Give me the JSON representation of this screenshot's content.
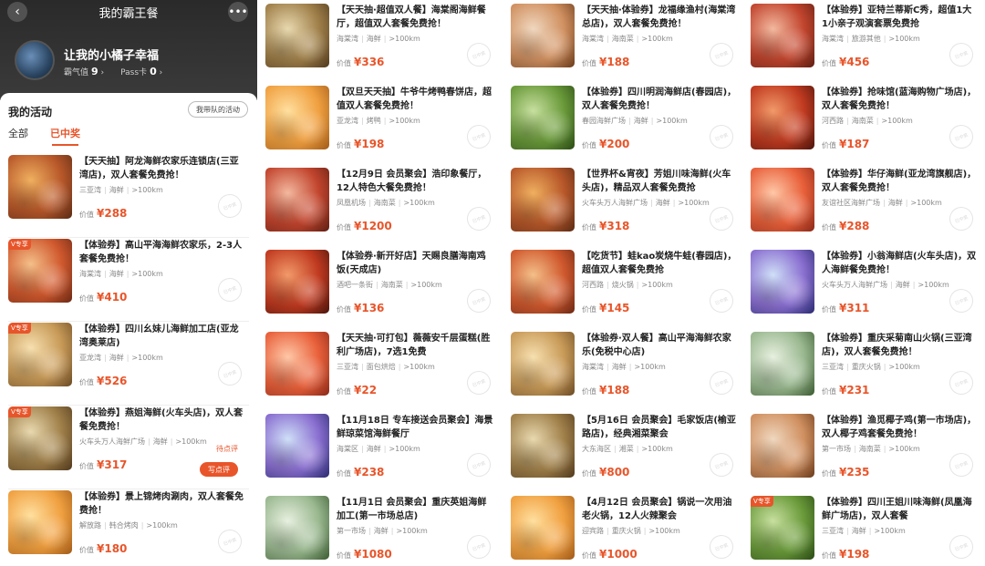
{
  "phone": {
    "title": "我的霸王餐",
    "back_icon": "chevron-left-icon",
    "more_icon": "more-dots-icon",
    "user_name": "让我的小橘子幸福",
    "popularity_label": "霸气值",
    "popularity_value": "9",
    "pass_label": "Pass卡",
    "pass_value": "0",
    "section_title": "我的活动",
    "team_button": "我带队的活动",
    "tabs": [
      "全部",
      "已中奖"
    ],
    "active_tab": "已中奖",
    "stamp_text": "已中奖",
    "pending_label": "待点评",
    "review_button": "写点评",
    "price_label": "价值",
    "accent_color": "#e8552a"
  },
  "phone_items": [
    {
      "title": "【天天抽】阿龙海鲜农家乐连锁店(三亚湾店)，双人套餐免费抢！",
      "area": "三亚湾",
      "cuisine": "海鲜",
      "distance": ">100km",
      "price": "¥288",
      "badge": ""
    },
    {
      "title": "【体验券】高山平海海鲜农家乐，2-3人套餐免费抢！",
      "area": "海棠湾",
      "cuisine": "海鲜",
      "distance": ">100km",
      "price": "¥410",
      "badge": "V专享"
    },
    {
      "title": "【体验券】四川幺妹儿海鲜加工店(亚龙湾奥莱店)",
      "area": "亚龙湾",
      "cuisine": "海鲜",
      "distance": ">100km",
      "price": "¥526",
      "badge": "V专享"
    },
    {
      "title": "【体验券】燕姐海鲜(火车头店)，双人套餐免费抢！",
      "area": "火车头万人海鲜广场",
      "cuisine": "海鲜",
      "distance": ">100km",
      "price": "¥317",
      "badge": "V专享",
      "pending": true
    },
    {
      "title": "【体验券】景上锦烤肉涮肉，双人套餐免费抢！",
      "area": "解放路",
      "cuisine": "韩合烤肉",
      "distance": ">100km",
      "price": "¥180",
      "badge": ""
    }
  ],
  "grid_columns": [
    [
      {
        "title": "【天天抽·超值双人餐】海棠阁海鲜餐厅，超值双人套餐免费抢！",
        "area": "海棠湾",
        "cuisine": "海鲜",
        "distance": ">100km",
        "price": "¥336",
        "badge": ""
      },
      {
        "title": "【双旦天天抽】牛爷牛烤鸭春饼店，超值双人套餐免费抢！",
        "area": "亚龙湾",
        "cuisine": "烤鸭",
        "distance": ">100km",
        "price": "¥198",
        "badge": ""
      },
      {
        "title": "【12月9日 会员聚会】浩印象餐厅，12人特色大餐免费抢！",
        "area": "凤凰机场",
        "cuisine": "海南菜",
        "distance": ">100km",
        "price": "¥1200",
        "badge": ""
      },
      {
        "title": "【体验券·新开好店】天赐良膳海南鸡饭(天成店)",
        "area": "酒吧一条街",
        "cuisine": "海南菜",
        "distance": ">100km",
        "price": "¥136",
        "badge": ""
      },
      {
        "title": "【天天抽·可打包】薇薇安千层蛋糕(胜利广场店)，7选1免费",
        "area": "三亚湾",
        "cuisine": "面包烘焙",
        "distance": ">100km",
        "price": "¥22",
        "badge": ""
      },
      {
        "title": "【11月18日 专车接送会员聚会】海景鲜琼菜馆海鲜餐厅",
        "area": "海棠区",
        "cuisine": "海鲜",
        "distance": ">100km",
        "price": "¥238",
        "badge": ""
      },
      {
        "title": "【11月1日 会员聚会】重庆英姐海鲜加工(第一市场总店)",
        "area": "第一市场",
        "cuisine": "海鲜",
        "distance": ">100km",
        "price": "¥1080",
        "badge": ""
      }
    ],
    [
      {
        "title": "【天天抽·体验券】龙福缘渔村(海棠湾总店)，双人套餐免费抢！",
        "area": "海棠湾",
        "cuisine": "海南菜",
        "distance": ">100km",
        "price": "¥188",
        "badge": ""
      },
      {
        "title": "【体验券】四川明润海鲜店(春园店)，双人套餐免费抢！",
        "area": "春园海鲜广场",
        "cuisine": "海鲜",
        "distance": ">100km",
        "price": "¥200",
        "badge": ""
      },
      {
        "title": "【世界杯&宵夜】芳姐川味海鲜(火车头店)，精品双人套餐免费抢",
        "area": "火车头万人海鲜广场",
        "cuisine": "海鲜",
        "distance": ">100km",
        "price": "¥318",
        "badge": ""
      },
      {
        "title": "【吃货节】蛙kao炭烧牛蛙(春园店)，超值双人套餐免费抢",
        "area": "河西路",
        "cuisine": "烧火锅",
        "distance": ">100km",
        "price": "¥145",
        "badge": ""
      },
      {
        "title": "【体验券·双人餐】高山平海海鲜农家乐(免税中心店)",
        "area": "海棠湾",
        "cuisine": "海鲜",
        "distance": ">100km",
        "price": "¥188",
        "badge": ""
      },
      {
        "title": "【5月16日 会员聚会】毛家饭店(榆亚路店)，经典湘菜聚会",
        "area": "大东海区",
        "cuisine": "湘菜",
        "distance": ">100km",
        "price": "¥800",
        "badge": ""
      },
      {
        "title": "【4月12日 会员聚会】锅说一次用油老火锅，12人火辣聚会",
        "area": "迎宾路",
        "cuisine": "重庆火锅",
        "distance": ">100km",
        "price": "¥1000",
        "badge": ""
      }
    ],
    [
      {
        "title": "【体验券】亚特兰蒂斯C秀，超值1大1小亲子观演套票免费抢",
        "area": "海棠湾",
        "cuisine": "旅游其他",
        "distance": ">100km",
        "price": "¥456",
        "badge": ""
      },
      {
        "title": "【体验券】抢味馆(蓝海购物广场店)，双人套餐免费抢！",
        "area": "河西路",
        "cuisine": "海南菜",
        "distance": ">100km",
        "price": "¥187",
        "badge": ""
      },
      {
        "title": "【体验券】华仔海鲜(亚龙湾旗舰店)，双人套餐免费抢！",
        "area": "友谊社区海鲜广场",
        "cuisine": "海鲜",
        "distance": ">100km",
        "price": "¥288",
        "badge": ""
      },
      {
        "title": "【体验券】小翁海鲜店(火车头店)，双人海鲜餐免费抢！",
        "area": "火车头万人海鲜广场",
        "cuisine": "海鲜",
        "distance": ">100km",
        "price": "¥311",
        "badge": ""
      },
      {
        "title": "【体验券】重庆采菊南山火锅(三亚湾店)，双人套餐免费抢！",
        "area": "三亚湾",
        "cuisine": "重庆火锅",
        "distance": ">100km",
        "price": "¥231",
        "badge": ""
      },
      {
        "title": "【体验券】渔觅椰子鸡(第一市场店)，双人椰子鸡套餐免费抢！",
        "area": "第一市场",
        "cuisine": "海南菜",
        "distance": ">100km",
        "price": "¥235",
        "badge": ""
      },
      {
        "title": "【体验券】四川王姐川味海鲜(凤凰海鲜广场店)，双人套餐",
        "area": "三亚湾",
        "cuisine": "海鲜",
        "distance": ">100km",
        "price": "¥198",
        "badge": "V专享"
      }
    ]
  ]
}
